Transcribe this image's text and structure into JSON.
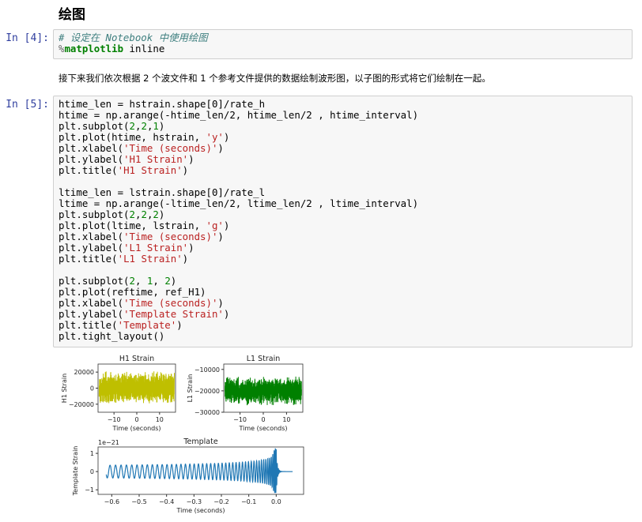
{
  "heading": "绘图",
  "cells": [
    {
      "prompt": "In [4]:",
      "lines": [
        [
          [
            "# 设定在 Notebook 中使用绘图",
            "c"
          ]
        ],
        [
          [
            "%",
            "o"
          ],
          [
            "matplotlib",
            "m"
          ],
          [
            " inline",
            ""
          ]
        ]
      ]
    },
    {
      "prompt": "In [5]:",
      "lines": [
        [
          [
            "htime_len = hstrain.shape[0]/rate_h",
            ""
          ]
        ],
        [
          [
            "htime = np.arange(-htime_len/2, htime_len/2 , htime_interval)",
            ""
          ]
        ],
        [
          [
            "plt.subplot(",
            ""
          ],
          [
            "2",
            "n"
          ],
          [
            ",",
            ""
          ],
          [
            "2",
            "n"
          ],
          [
            ",",
            ""
          ],
          [
            "1",
            "n"
          ],
          [
            ")",
            ""
          ]
        ],
        [
          [
            "plt.plot(htime, hstrain, ",
            ""
          ],
          [
            "'y'",
            "s"
          ],
          [
            ")",
            ""
          ]
        ],
        [
          [
            "plt.xlabel(",
            ""
          ],
          [
            "'Time (seconds)'",
            "s"
          ],
          [
            ")",
            ""
          ]
        ],
        [
          [
            "plt.ylabel(",
            ""
          ],
          [
            "'H1 Strain'",
            "s"
          ],
          [
            ")",
            ""
          ]
        ],
        [
          [
            "plt.title(",
            ""
          ],
          [
            "'H1 Strain'",
            "s"
          ],
          [
            ")",
            ""
          ]
        ],
        [
          [
            "",
            ""
          ]
        ],
        [
          [
            "ltime_len = lstrain.shape[0]/rate_l",
            ""
          ]
        ],
        [
          [
            "ltime = np.arange(-ltime_len/2, ltime_len/2 , ltime_interval)",
            ""
          ]
        ],
        [
          [
            "plt.subplot(",
            ""
          ],
          [
            "2",
            "n"
          ],
          [
            ",",
            ""
          ],
          [
            "2",
            "n"
          ],
          [
            ",",
            ""
          ],
          [
            "2",
            "n"
          ],
          [
            ")",
            ""
          ]
        ],
        [
          [
            "plt.plot(ltime, lstrain, ",
            ""
          ],
          [
            "'g'",
            "s"
          ],
          [
            ")",
            ""
          ]
        ],
        [
          [
            "plt.xlabel(",
            ""
          ],
          [
            "'Time (seconds)'",
            "s"
          ],
          [
            ")",
            ""
          ]
        ],
        [
          [
            "plt.ylabel(",
            ""
          ],
          [
            "'L1 Strain'",
            "s"
          ],
          [
            ")",
            ""
          ]
        ],
        [
          [
            "plt.title(",
            ""
          ],
          [
            "'L1 Strain'",
            "s"
          ],
          [
            ")",
            ""
          ]
        ],
        [
          [
            "",
            ""
          ]
        ],
        [
          [
            "plt.subplot(",
            ""
          ],
          [
            "2",
            "n"
          ],
          [
            ", ",
            ""
          ],
          [
            "1",
            "n"
          ],
          [
            ", ",
            ""
          ],
          [
            "2",
            "n"
          ],
          [
            ")",
            ""
          ]
        ],
        [
          [
            "plt.plot(reftime, ref_H1)",
            ""
          ]
        ],
        [
          [
            "plt.xlabel(",
            ""
          ],
          [
            "'Time (seconds)'",
            "s"
          ],
          [
            ")",
            ""
          ]
        ],
        [
          [
            "plt.ylabel(",
            ""
          ],
          [
            "'Template Strain'",
            "s"
          ],
          [
            ")",
            ""
          ]
        ],
        [
          [
            "plt.title(",
            ""
          ],
          [
            "'Template'",
            "s"
          ],
          [
            ")",
            ""
          ]
        ],
        [
          [
            "plt.tight_layout()",
            ""
          ]
        ]
      ]
    }
  ],
  "markdown": "接下来我们依次根据 2 个波文件和 1 个参考文件提供的数据绘制波形图，以子图的形式将它们绘制在一起。",
  "chart_data": [
    {
      "type": "line",
      "title": "H1 Strain",
      "xlabel": "Time (seconds)",
      "ylabel": "H1 Strain",
      "color": "#bfbf00",
      "xlim": [
        -17,
        17
      ],
      "ylim": [
        -30000,
        30000
      ],
      "xticks": [
        -10,
        0,
        10
      ],
      "xticklabels": [
        "−10",
        "0",
        "10"
      ],
      "yticks": [
        20000,
        0,
        -20000
      ],
      "yticklabels": [
        "20000",
        "0",
        "−20000"
      ],
      "center": 0,
      "amplitude": 21000,
      "peak": 28000
    },
    {
      "type": "line",
      "title": "L1 Strain",
      "xlabel": "Time (seconds)",
      "ylabel": "L1 Strain",
      "color": "#008000",
      "xlim": [
        -17,
        17
      ],
      "ylim": [
        -30000,
        -7500
      ],
      "xticks": [
        -10,
        0,
        10
      ],
      "xticklabels": [
        "−10",
        "0",
        "10"
      ],
      "yticks": [
        -10000,
        -20000,
        -30000
      ],
      "yticklabels": [
        "−10000",
        "−20000",
        "−30000"
      ],
      "center": -20000,
      "amplitude": 7000,
      "peak": 11000
    },
    {
      "type": "line",
      "title": "Template",
      "xlabel": "Time (seconds)",
      "ylabel": "Template Strain",
      "offset_label": "1e−21",
      "color": "#1f77b4",
      "xlim": [
        -0.65,
        0.1
      ],
      "ylim": [
        -1.25,
        1.35
      ],
      "xticks": [
        -0.6,
        -0.5,
        -0.4,
        -0.3,
        -0.2,
        -0.1,
        0.0
      ],
      "xticklabels": [
        "−0.6",
        "−0.5",
        "−0.4",
        "−0.3",
        "−0.2",
        "−0.1",
        "0.0"
      ],
      "yticks": [
        1,
        0,
        -1
      ],
      "yticklabels": [
        "1",
        "0",
        "−1"
      ],
      "t_range": [
        -0.62,
        0.06
      ],
      "merger_time": 0.0,
      "amplitude_start": 0.35,
      "amplitude_peak": 1.25
    }
  ]
}
